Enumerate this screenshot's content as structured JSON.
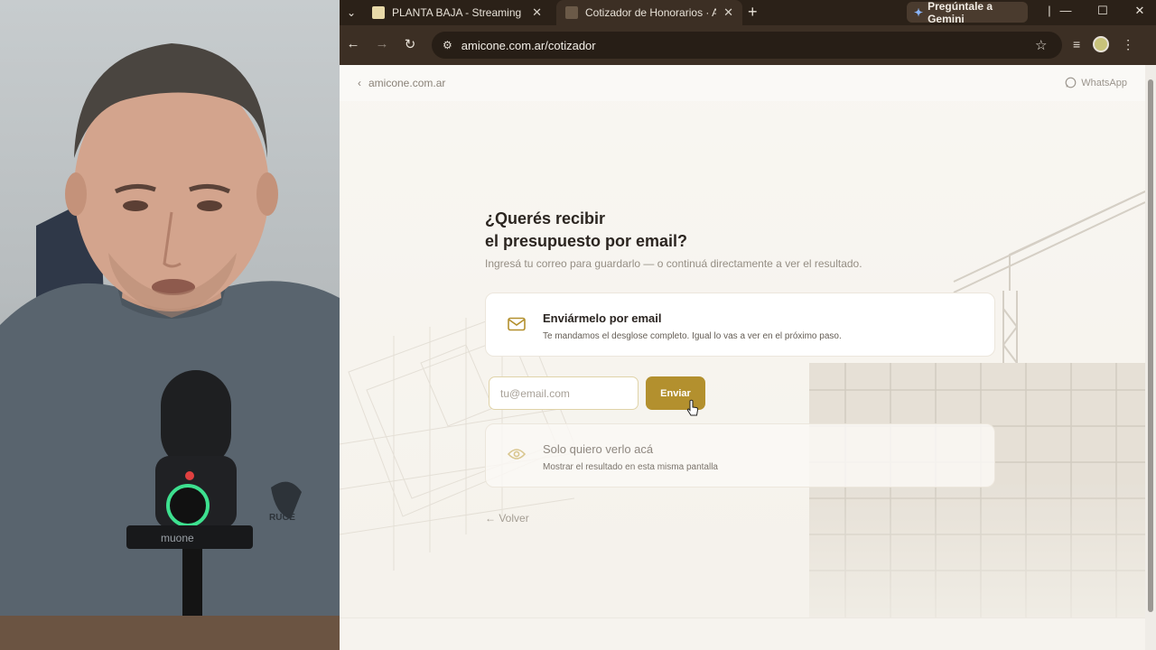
{
  "browser": {
    "tabs": [
      {
        "title": "PLANTA BAJA - Streaming de Agustín",
        "active": false
      },
      {
        "title": "Cotizador de Honorarios · Agustín Amicone",
        "active": true
      }
    ],
    "gemini_label": "Pregúntale a Gemini",
    "url": "amicone.com.ar/cotizador"
  },
  "site": {
    "back_label": "amicone.com.ar",
    "whatsapp_label": "WhatsApp"
  },
  "main": {
    "heading_line1": "¿Querés recibir",
    "heading_line2": "el presupuesto por email?",
    "subheading": "Ingresá tu correo para guardarlo — o continuá directamente a ver el resultado.",
    "option_email": {
      "title": "Enviármelo por email",
      "description": "Te mandamos el desglose completo. Igual lo vas a ver en el próximo paso."
    },
    "email_input": {
      "placeholder": "tu@email.com",
      "value": ""
    },
    "send_label": "Enviar",
    "option_here": {
      "title": "Solo quiero verlo acá",
      "description": "Mostrar el resultado en esta misma pantalla"
    },
    "back_label": "← Volver"
  },
  "colors": {
    "accent": "#b3902e",
    "chrome": "#3c2f24"
  },
  "icons": {
    "email_option": "mail-icon",
    "here_option": "eye-icon",
    "whatsapp": "whatsapp-icon"
  }
}
